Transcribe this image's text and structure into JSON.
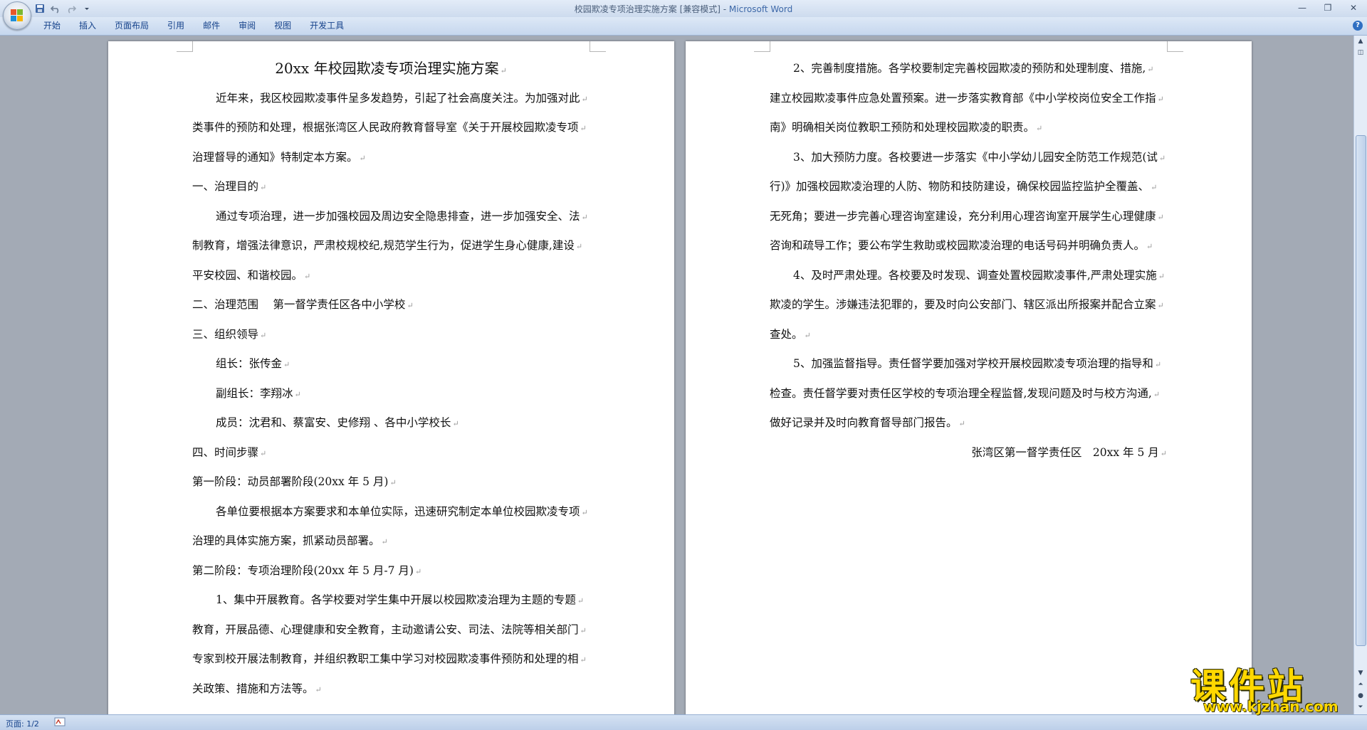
{
  "window": {
    "title": "校园欺凌专项治理实施方案 [兼容模式] - ",
    "app_name": "Microsoft Word",
    "controls": [
      "—",
      "❐",
      "✕"
    ]
  },
  "quick_access": {
    "icons": [
      "save-icon",
      "undo-icon",
      "redo-icon",
      "customize-icon"
    ]
  },
  "ribbon": {
    "tabs": [
      "开始",
      "插入",
      "页面布局",
      "引用",
      "邮件",
      "审阅",
      "视图",
      "开发工具"
    ],
    "help": "?"
  },
  "page1": {
    "lines": [
      {
        "text": "20xx 年校园欺凌专项治理实施方案",
        "style": "title"
      },
      {
        "text": "近年来，我区校园欺凌事件呈多发趋势，引起了社会高度关注。为加强对此",
        "style": "indent"
      },
      {
        "text": "类事件的预防和处理，根据张湾区人民政府教育督导室《关于开展校园欺凌专项",
        "style": ""
      },
      {
        "text": "治理督导的通知》特制定本方案。",
        "style": ""
      },
      {
        "text": "一、治理目的",
        "style": ""
      },
      {
        "text": "通过专项治理，进一步加强校园及周边安全隐患排查，进一步加强安全、法",
        "style": "indent"
      },
      {
        "text": "制教育，增强法律意识，严肃校规校纪,规范学生行为，促进学生身心健康,建设",
        "style": ""
      },
      {
        "text": "平安校园、和谐校园。",
        "style": ""
      },
      {
        "text": "二、治理范围　 第一督学责任区各中小学校",
        "style": ""
      },
      {
        "text": "三、组织领导",
        "style": ""
      },
      {
        "text": "组长：张传金",
        "style": "indent"
      },
      {
        "text": "副组长：李翔冰",
        "style": "indent"
      },
      {
        "text": "成员：沈君和、蔡富安、史修翔 、各中小学校长",
        "style": "indent"
      },
      {
        "text": "四、时间步骤",
        "style": ""
      },
      {
        "text": "第一阶段：动员部署阶段(20xx 年 5 月)",
        "style": ""
      },
      {
        "text": "各单位要根据本方案要求和本单位实际，迅速研究制定本单位校园欺凌专项",
        "style": "indent"
      },
      {
        "text": "治理的具体实施方案，抓紧动员部署。",
        "style": ""
      },
      {
        "text": "第二阶段：专项治理阶段(20xx 年 5 月-7 月)",
        "style": ""
      },
      {
        "text": "1、集中开展教育。各学校要对学生集中开展以校园欺凌治理为主题的专题",
        "style": "indent"
      },
      {
        "text": "教育，开展品德、心理健康和安全教育，主动邀请公安、司法、法院等相关部门",
        "style": ""
      },
      {
        "text": "专家到校开展法制教育，并组织教职工集中学习对校园欺凌事件预防和处理的相",
        "style": ""
      },
      {
        "text": "关政策、措施和方法等。",
        "style": ""
      }
    ]
  },
  "page2": {
    "lines": [
      {
        "text": "2、完善制度措施。各学校要制定完善校园欺凌的预防和处理制度、措施,",
        "style": "indent"
      },
      {
        "text": "建立校园欺凌事件应急处置预案。进一步落实教育部《中小学校岗位安全工作指",
        "style": ""
      },
      {
        "text": "南》明确相关岗位教职工预防和处理校园欺凌的职责。",
        "style": ""
      },
      {
        "text": "3、加大预防力度。各校要进一步落实《中小学幼儿园安全防范工作规范(试",
        "style": "indent"
      },
      {
        "text": "行)》加强校园欺凌治理的人防、物防和技防建设，确保校园监控监护全覆盖、",
        "style": ""
      },
      {
        "text": "无死角；要进一步完善心理咨询室建设，充分利用心理咨询室开展学生心理健康",
        "style": ""
      },
      {
        "text": "咨询和疏导工作；要公布学生救助或校园欺凌治理的电话号码并明确负责人。",
        "style": ""
      },
      {
        "text": "4、及时严肃处理。各校要及时发现、调查处置校园欺凌事件,严肃处理实施",
        "style": "indent"
      },
      {
        "text": "欺凌的学生。涉嫌违法犯罪的，要及时向公安部门、辖区派出所报案并配合立案",
        "style": ""
      },
      {
        "text": "查处。",
        "style": ""
      },
      {
        "text": "5、加强监督指导。责任督学要加强对学校开展校园欺凌专项治理的指导和",
        "style": "indent"
      },
      {
        "text": "检查。责任督学要对责任区学校的专项治理全程监督,发现问题及时与校方沟通,",
        "style": ""
      },
      {
        "text": "做好记录并及时向教育督导部门报告。",
        "style": ""
      },
      {
        "text": "张湾区第一督学责任区　20xx 年 5 月",
        "style": "right"
      }
    ]
  },
  "paragraph_mark": "↵",
  "status_bar": {
    "page_count": "页面: 1/2"
  },
  "watermark": {
    "main": "课件站",
    "url": "www.kjzhan.com"
  },
  "colors": {
    "doc_background": "#a3aab5",
    "ribbon_text": "#15428b",
    "watermark": "#ffd800"
  }
}
